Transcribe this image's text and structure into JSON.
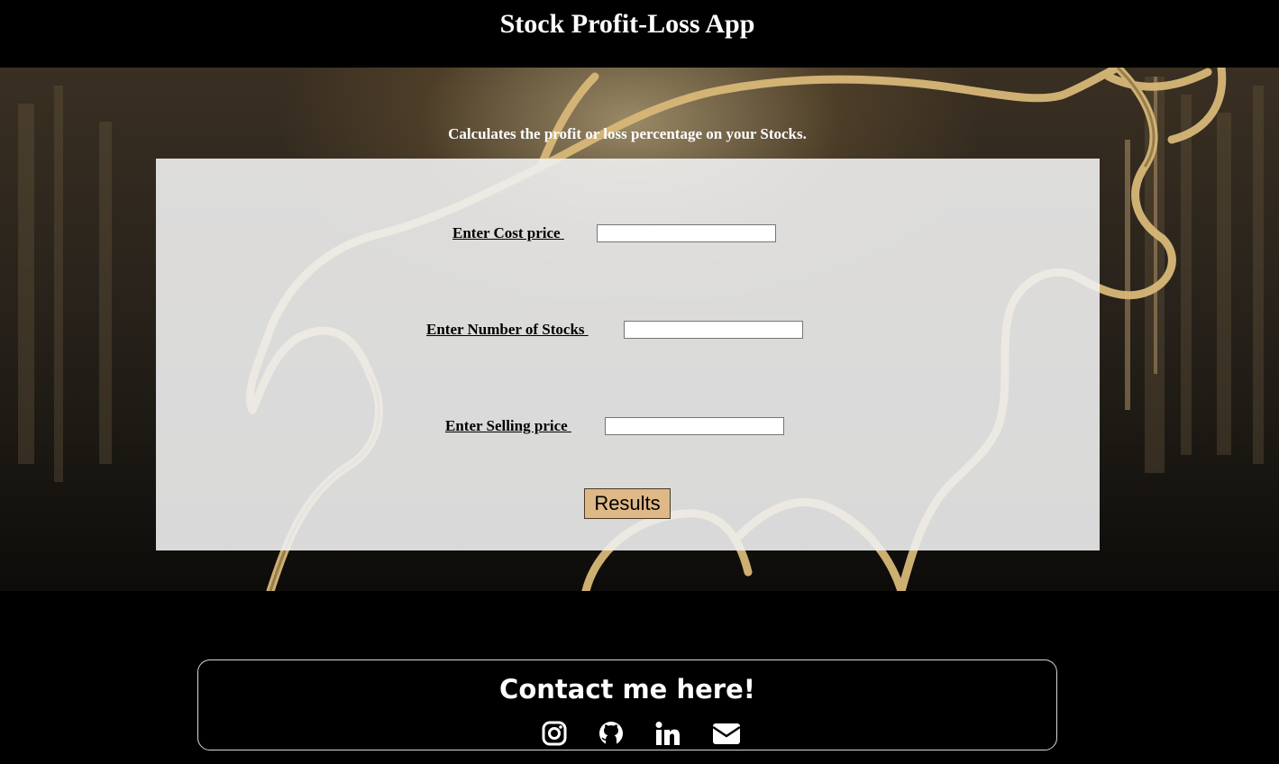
{
  "header": {
    "title": "Stock Profit-Loss App"
  },
  "hero": {
    "tagline": "Calculates the profit or loss percentage on your Stocks."
  },
  "form": {
    "cost_price_label": "Enter Cost price ",
    "cost_price_value": "",
    "stocks_label": "Enter Number of Stocks ",
    "stocks_value": "",
    "selling_price_label": "Enter Selling price ",
    "selling_price_value": "",
    "results_label": "Results"
  },
  "contact": {
    "title": "Contact me here!",
    "icons": [
      "instagram-icon",
      "github-icon",
      "linkedin-icon",
      "email-icon"
    ]
  },
  "colors": {
    "page_background": "#000000",
    "panel": "#f0f0f0",
    "button": "#deb887",
    "text_light": "#ffffff"
  }
}
